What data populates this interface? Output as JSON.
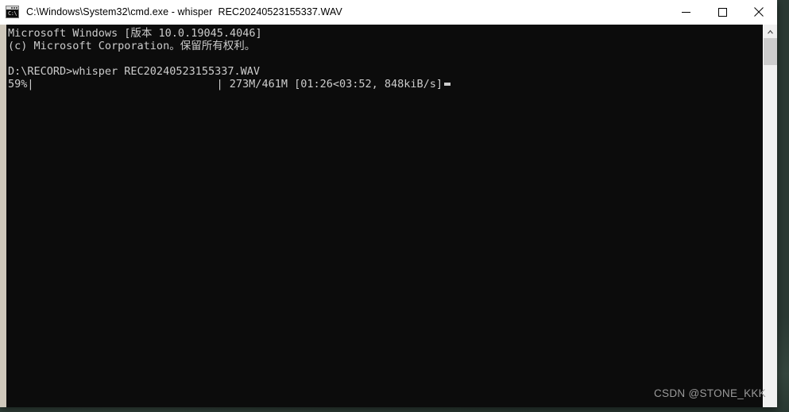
{
  "window": {
    "title": "C:\\Windows\\System32\\cmd.exe - whisper  REC20240523155337.WAV",
    "icon": "cmd-console-icon",
    "icon_prompt": "C:\\",
    "controls": {
      "minimize": "minimize-button",
      "maximize": "maximize-button",
      "close": "close-button"
    }
  },
  "console": {
    "lines": [
      "Microsoft Windows [版本 10.0.19045.4046]",
      "(c) Microsoft Corporation。保留所有权利。",
      "",
      "D:\\RECORD>whisper REC20240523155337.WAV"
    ],
    "progress": {
      "percent_label": "59%",
      "percent_value": 59,
      "bar_open": "|",
      "bar_close": "|",
      "stats": " 273M/461M [01:26<03:52, 848kiB/s]",
      "cursor": "block-cursor"
    },
    "colors": {
      "background": "#0c0c0c",
      "foreground": "#cccccc",
      "bar_fill": "#c8c8c8"
    }
  },
  "scrollbar": {
    "up_arrow": "scroll-up-arrow-icon",
    "thumb": "scrollbar-thumb"
  },
  "watermark": {
    "text": "CSDN @STONE_KKK"
  }
}
